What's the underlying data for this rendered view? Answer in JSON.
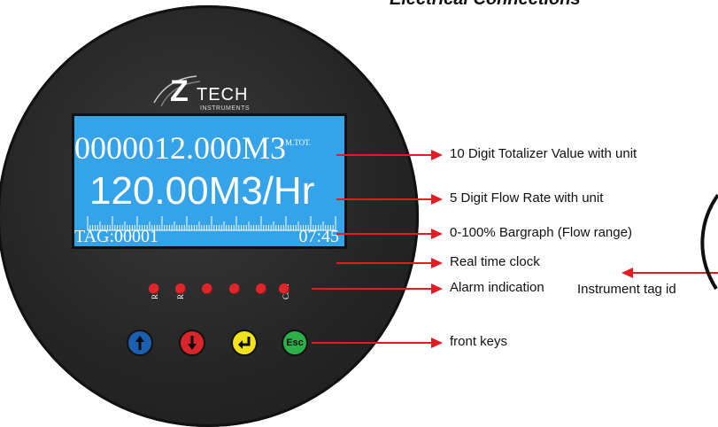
{
  "heading": "Electrical Connections",
  "logo": {
    "mark": "Z",
    "brand": "TECH",
    "subtitle": "INSTRUMENTS"
  },
  "display": {
    "totalizer": "0000012.000M3",
    "totalizer_tag": "M.TOT.",
    "flow_rate": "120.00M3/Hr",
    "tag": "TAG:00001",
    "clock": "07:45"
  },
  "leds": {
    "labels": [
      "R1",
      "R2",
      "Com"
    ],
    "count": 6,
    "color": "#e0262b"
  },
  "keys": [
    {
      "name": "up",
      "icon": "arrow-up-icon",
      "color": "#1a5fb0"
    },
    {
      "name": "down",
      "icon": "arrow-down-icon",
      "color": "#d8262b"
    },
    {
      "name": "enter",
      "icon": "enter-icon",
      "color": "#f2e21e"
    },
    {
      "name": "esc",
      "label": "Esc",
      "color": "#2cb14a"
    }
  ],
  "callouts": {
    "totalizer": "10 Digit Totalizer Value with unit",
    "flow_rate": "5 Digit Flow Rate with unit",
    "bargraph": "0-100% Bargraph (Flow range)",
    "clock": "Real time clock",
    "tag": "Instrument tag id",
    "alarm": "Alarm indication",
    "keys": "front keys"
  },
  "colors": {
    "arrow": "#e31b23",
    "lcd": "#34a3ea",
    "bezel": "#262626"
  }
}
